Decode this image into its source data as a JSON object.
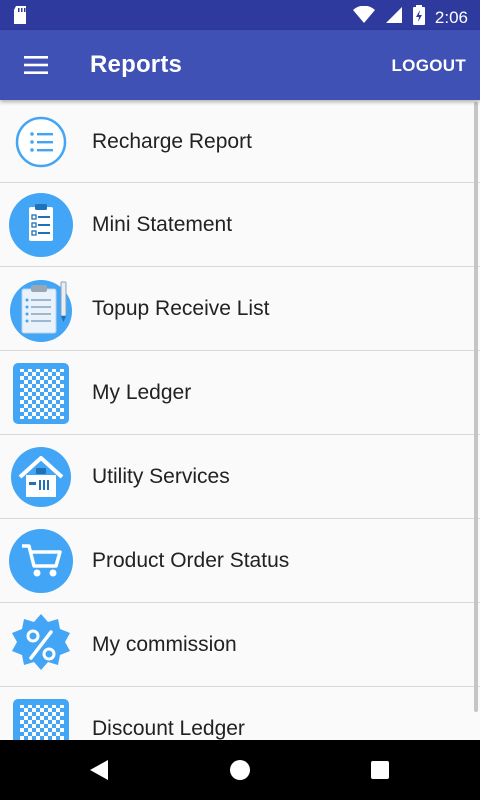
{
  "status": {
    "time": "2:06"
  },
  "appbar": {
    "title": "Reports",
    "logout": "LOGOUT"
  },
  "items": [
    {
      "label": "Recharge Report",
      "icon": "list-icon"
    },
    {
      "label": "Mini Statement",
      "icon": "clipboard-checklist-icon"
    },
    {
      "label": "Topup Receive List",
      "icon": "clipboard-pen-icon"
    },
    {
      "label": "My Ledger",
      "icon": "ledger-book-icon"
    },
    {
      "label": "Utility Services",
      "icon": "utility-house-icon"
    },
    {
      "label": "Product Order Status",
      "icon": "shopping-cart-icon"
    },
    {
      "label": "My commission",
      "icon": "percent-badge-icon"
    },
    {
      "label": "Discount Ledger",
      "icon": "ledger-book-icon"
    }
  ],
  "colors": {
    "statusbar": "#2f3a9e",
    "appbar": "#3f51b5",
    "icon_blue": "#42a5f5"
  }
}
